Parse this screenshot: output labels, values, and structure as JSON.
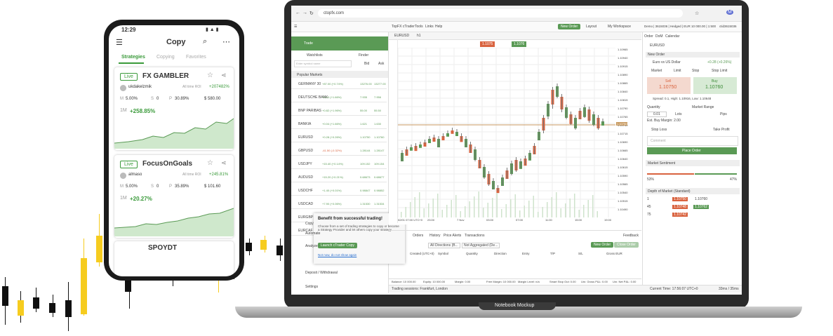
{
  "phone": {
    "status_time": "12:29",
    "title": "Copy",
    "tabs": [
      "Strategies",
      "Copying",
      "Favorites"
    ],
    "cards": [
      {
        "badge": "Live",
        "name": "FX GAMBLER",
        "user": "ukdakelzmik",
        "stat_label": "All time ROI",
        "stat_value": "+207482%",
        "m_label": "M",
        "m_value": "5.00%",
        "s_label": "S",
        "s_value": "0",
        "p_label": "P",
        "p_value": "30.89%",
        "c_value": "$ 580.00",
        "period": "1M",
        "return": "+258.85%"
      },
      {
        "badge": "Live",
        "name": "FocusOnGoals",
        "user": "almaso",
        "stat_label": "All time ROI",
        "stat_value": "+245.81%",
        "m_label": "M",
        "m_value": "5.00%",
        "s_label": "S",
        "s_value": "0",
        "p_label": "P",
        "p_value": "35.89%",
        "c_value": "$ 101.60",
        "period": "1M",
        "return": "+20.27%"
      },
      {
        "name": "SPOYDT"
      }
    ]
  },
  "laptop": {
    "url": "ctopfx.com",
    "menu": [
      "TopFX cTrader",
      "Tools",
      "Links",
      "Help"
    ],
    "new_order": "New Order",
    "layout": "Layout",
    "workspace": "My Workspace",
    "account": "Demo | 3615036 | Hedged | EUR 10 000.00 | 1:500",
    "account_id": "ctid3615036",
    "trade_label": "Trade",
    "tabs": [
      "Watchlists",
      "Finder"
    ],
    "search_placeholder": "Enter symbol name",
    "cols": [
      "Bid",
      "Ask"
    ],
    "section": "Popular Markets",
    "symbols": [
      {
        "name": "GERMANY 30",
        "change": "+87.00 (+0.74%)",
        "bid": "13276.00",
        "ask": "13277.00"
      },
      {
        "name": "DEUTSCHE BANK",
        "change": "+0.13 (+1.66%)",
        "bid": "7.935",
        "ask": "7.956"
      },
      {
        "name": "BNP PARIBAS",
        "change": "+0.82 (+1.96%)",
        "bid": "55.00",
        "ask": "55.50"
      },
      {
        "name": "BANKIA",
        "change": "+0.04 (+1.66%)",
        "bid": "1.621",
        "ask": "1.630"
      },
      {
        "name": "EURUSD",
        "change": "+0.28 (+0.26%)",
        "bid": "1.10750",
        "ask": "1.10760"
      },
      {
        "name": "GBPUSD",
        "change": "-41.50 (-0.32%)",
        "bid": "1.28144",
        "ask": "1.28147"
      },
      {
        "name": "USDJPY",
        "change": "+15.40 (+0.14%)",
        "bid": "109.152",
        "ask": "109.154"
      },
      {
        "name": "AUDUSD",
        "change": "+15.20 (+0.21%)",
        "bid": "0.68673",
        "ask": "0.68677"
      },
      {
        "name": "USDCHF",
        "change": "+1.40 (+0.01%)",
        "bid": "0.98847",
        "ask": "0.98852"
      },
      {
        "name": "USDCAD",
        "change": "+7.90 (+0.06%)",
        "bid": "1.31530",
        "ask": "1.31534"
      },
      {
        "name": "EURGBP",
        "change": "+41.60 (+0.49%)",
        "bid": "0.86431",
        "ask": "0.86436"
      },
      {
        "name": "EURCAF",
        "change": "+1.10 (+0.01%)",
        "bid": "1.06873",
        "ask": "1.06877"
      }
    ],
    "chart_tab": "EURUSD",
    "chart_tf": "h1",
    "sell_price": "1.1075",
    "buy_price": "1.1076",
    "price_axis": [
      "1.10965",
      "1.10940",
      "1.10915",
      "1.10890",
      "1.10865",
      "1.10840",
      "1.10815",
      "1.10790",
      "1.10765",
      "1.10740",
      "1.10715",
      "1.10690",
      "1.10665",
      "1.10640",
      "1.10615",
      "1.10590",
      "1.10565",
      "1.10540",
      "1.10515",
      "1.10490"
    ],
    "current_price": "1.10750",
    "time_axis": [
      "02/01 07:00 UTC+0",
      "23:00",
      "7 Nov",
      "03:00",
      "07:00",
      "11:00",
      "15:00",
      "19:00"
    ],
    "popup": {
      "title": "Benefit from successful trading!",
      "body": "Choose from a set of trading strategies to copy or become a Strategy Provider and let others copy your strategy.",
      "button": "Launch cTrader Copy",
      "link": "Not now, do not show again",
      "close": "x"
    },
    "side_menu": [
      "Copy",
      "Automate",
      "Analyze",
      "Deposit / Withdrawal",
      "Settings"
    ],
    "bottom_tabs": [
      "Orders",
      "History",
      "Price Alerts",
      "Transactions"
    ],
    "feedback": "Feedback",
    "filters": [
      "All Directions (B...",
      "Not Aggregated (De..."
    ],
    "order_cols": [
      "Created (UTC+0)",
      "Symbol",
      "Quantity",
      "Direction",
      "Entry",
      "T/P",
      "S/L",
      "Gross EUR"
    ],
    "new_order_btn": "New Order",
    "close_order_btn": "Close Order",
    "footer_stats": [
      "Balance: 10 000.00",
      "Equity: 10 000.00",
      "Margin: 0.00",
      "Free Margin: 10 000.00",
      "Margin Level: n/a",
      "Smart Stop Out: 0.00",
      "Unr. Gross P&L: 0.00",
      "Unr. Net P&L: 0.00"
    ],
    "session": "Trading sessions: Frankfurt, London",
    "clock": "Current Time: 17:56:07  UTC+0",
    "latency": "33ms / 35ms",
    "right_panel": {
      "tabs": [
        "Order",
        "DoM",
        "Calendar"
      ],
      "symbol": "EURUSD",
      "section": "New Order",
      "pair_name": "Euro vs US Dollar",
      "pair_change": "+0.28 (+0.26%)",
      "order_types": [
        "Market",
        "Limit",
        "Stop",
        "Stop Limit"
      ],
      "sell_label": "Sell",
      "sell": "1.10750",
      "buy_label": "Buy",
      "buy": "1.10760",
      "spread": "Spread: 0.1, High: 1.10916, Low: 1.10648",
      "qty_label": "Quantity",
      "qty": "0.01",
      "lots": "Lots",
      "market_range": "Market Range",
      "pips": "Pips",
      "margin_est": "Est. Buy Margin: 2.00",
      "stop_loss": "Stop Loss",
      "take_profit": "Take Profit",
      "comment": "Comment",
      "place_order": "Place Order",
      "sentiment_title": "Market Sentiment",
      "sentiment_sell": "53%",
      "sentiment_buy": "47%",
      "dom_title": "Depth of Market (Standard)",
      "dom_rows": [
        {
          "vol": "1",
          "bid": "1.10750",
          "ask": "1.10760"
        },
        {
          "vol": "45",
          "bid": "1.10748",
          "ask": "1.10762"
        },
        {
          "vol": "75",
          "bid": "1.10742",
          "ask": ""
        }
      ]
    },
    "caption": "Notebook Mockup"
  },
  "colors": {
    "green": "#5a9a55",
    "red": "#d9633f",
    "yellow": "#f6cc1f"
  }
}
